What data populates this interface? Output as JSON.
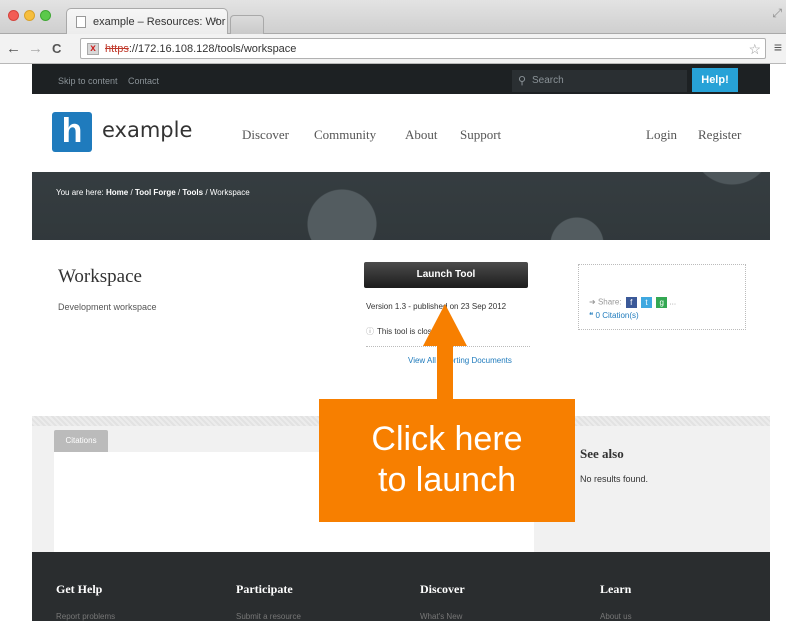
{
  "browser": {
    "tab_title": "example – Resources: Wor",
    "tab_close": "×",
    "url_scheme": "https",
    "url_rest": "://172.16.108.128/tools/workspace",
    "back": "←",
    "forward": "→",
    "reload": "C",
    "star": "☆",
    "menu": "≡",
    "resize": "⤢",
    "lock_glyph": "x"
  },
  "site": {
    "skip_content": "Skip to content",
    "contact": "Contact",
    "search_placeholder": "Search",
    "help_button": "Help!",
    "logo_letter": "h",
    "logo_text": "example",
    "nav": [
      "Discover",
      "Community",
      "About",
      "Support"
    ],
    "login": "Login",
    "register": "Register",
    "breadcrumb_prefix": "You are here:",
    "breadcrumb_items": [
      "Home",
      "Tool Forge",
      "Tools",
      "Workspace"
    ],
    "breadcrumb_sep": "/"
  },
  "tool": {
    "title": "Workspace",
    "subtitle": "Development workspace",
    "launch_button": "Launch Tool",
    "version": "Version 1.3 - published on 23 Sep 2012",
    "closed_source": "This tool is clos...urce.",
    "view_docs": "View All ...porting Documents",
    "share_label": "Share:",
    "share_more": "...",
    "citations": "0 Citation(s)"
  },
  "content": {
    "citations_tab": "Citations",
    "see_also": "See also",
    "no_results": "No results found."
  },
  "footer": {
    "columns": [
      "Get Help",
      "Participate",
      "Discover",
      "Learn"
    ],
    "sub": [
      "Report problems",
      "Submit a resource",
      "What's New",
      "About us"
    ]
  },
  "annotation": {
    "line1": "Click here",
    "line2": "to launch",
    "color": "#f77f00"
  },
  "colors": {
    "accent": "#27a2d7",
    "brand": "#1f7bbd"
  }
}
